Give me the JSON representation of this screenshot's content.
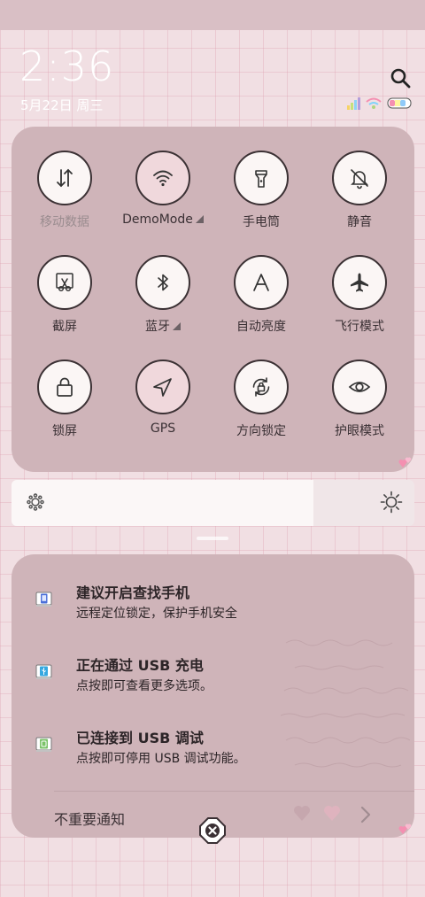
{
  "status": {
    "time": "2:36",
    "date": "5月22日 周三"
  },
  "quick_settings": {
    "tiles": [
      {
        "label": "移动数据",
        "icon": "data-arrows-icon",
        "state": "off"
      },
      {
        "label": "DemoMode",
        "icon": "wifi-icon",
        "state": "on",
        "expandable": true
      },
      {
        "label": "手电筒",
        "icon": "flashlight-icon",
        "state": "off"
      },
      {
        "label": "静音",
        "icon": "bell-off-icon",
        "state": "off"
      },
      {
        "label": "截屏",
        "icon": "screenshot-scissors-icon",
        "state": "off"
      },
      {
        "label": "蓝牙",
        "icon": "bluetooth-icon",
        "state": "off",
        "expandable": true
      },
      {
        "label": "自动亮度",
        "icon": "auto-brightness-icon",
        "state": "off"
      },
      {
        "label": "飞行模式",
        "icon": "airplane-icon",
        "state": "off"
      },
      {
        "label": "锁屏",
        "icon": "lock-icon",
        "state": "off"
      },
      {
        "label": "GPS",
        "icon": "location-arrow-icon",
        "state": "on"
      },
      {
        "label": "方向锁定",
        "icon": "rotation-lock-icon",
        "state": "off"
      },
      {
        "label": "护眼模式",
        "icon": "eye-icon",
        "state": "off"
      }
    ],
    "page_count": 2,
    "current_page": 1
  },
  "brightness": {
    "level": 0.75
  },
  "notifications": [
    {
      "title": "建议开启查找手机",
      "body": "远程定位锁定，保护手机安全",
      "icon": "find-phone-icon"
    },
    {
      "title": "正在通过 USB 充电",
      "body": "点按即可查看更多选项。",
      "icon": "usb-icon"
    },
    {
      "title": "已连接到 USB 调试",
      "body": "点按即可停用 USB 调试功能。",
      "icon": "android-debug-icon"
    }
  ],
  "unimportant_label": "不重要通知",
  "colors": {
    "accent_pink": "#f0d8dc",
    "panel": "#cfb4b9",
    "background": "#f1dfe3"
  }
}
